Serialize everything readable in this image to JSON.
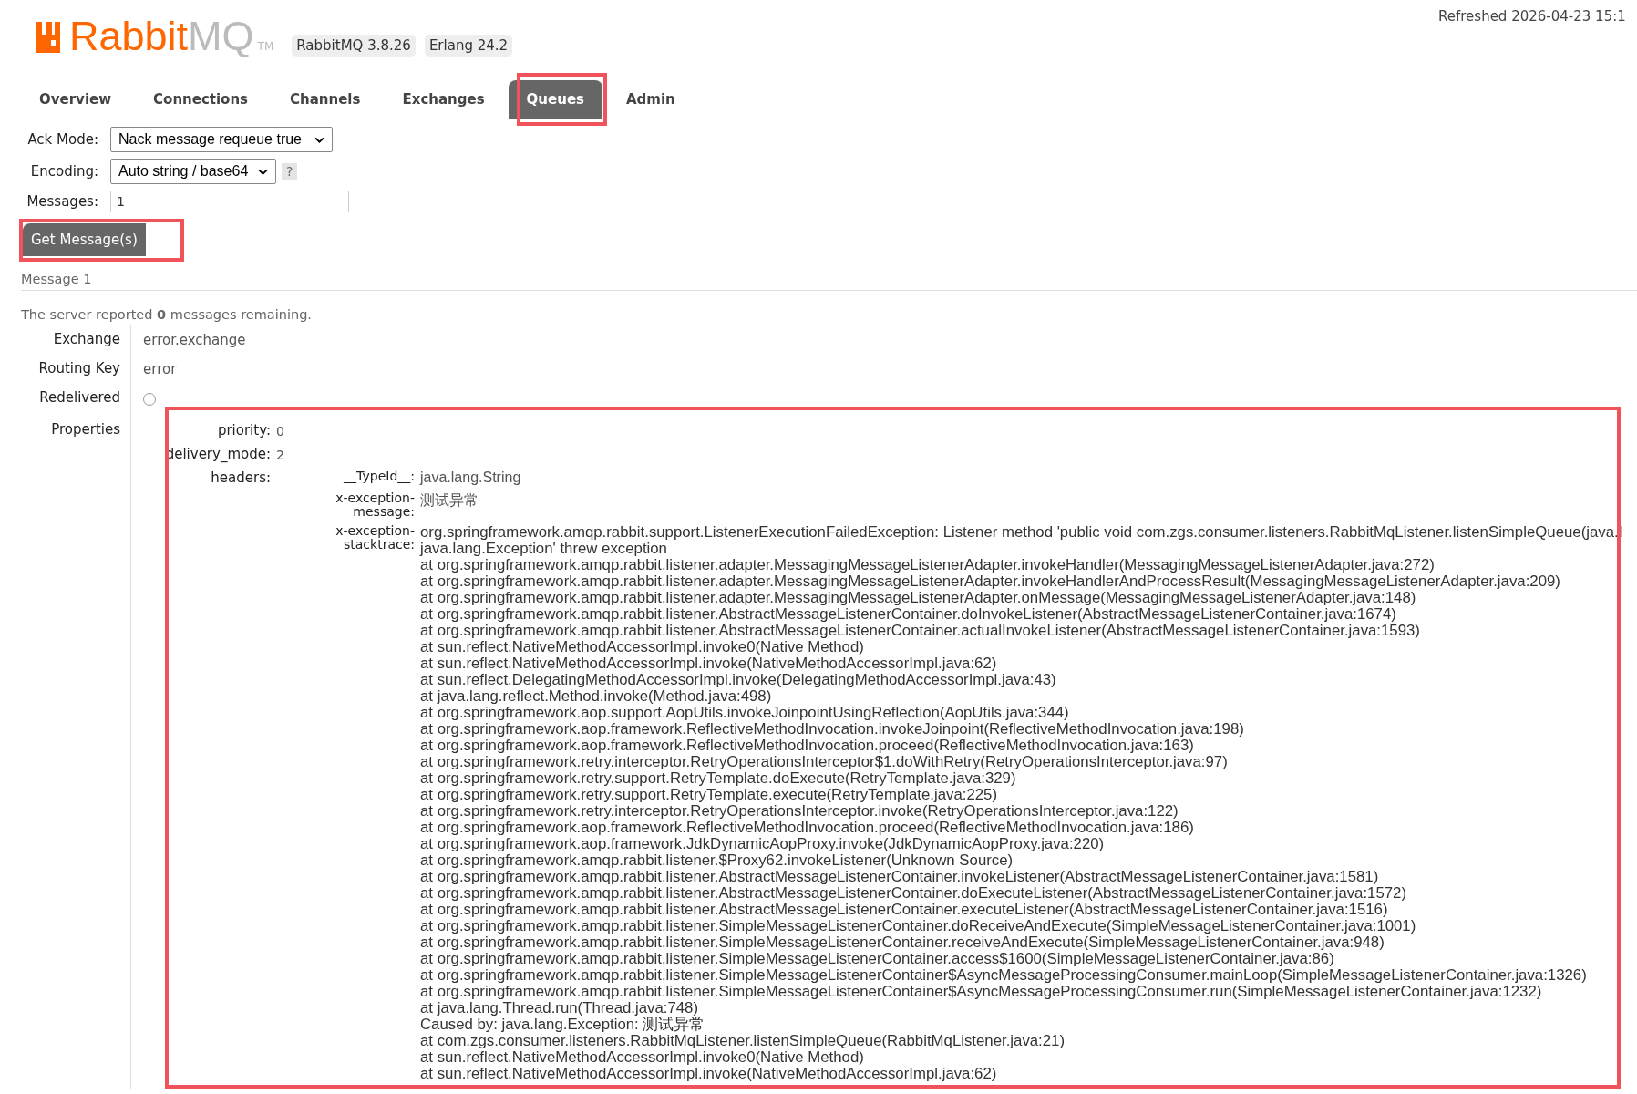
{
  "header": {
    "logo": {
      "brand": "Rabbit",
      "suffix": "MQ",
      "mark": "TM"
    },
    "badges": [
      "RabbitMQ 3.8.26",
      "Erlang 24.2"
    ],
    "refreshed": "Refreshed 2026-04-23 15:1"
  },
  "tabs": [
    {
      "label": "Overview",
      "selected": false
    },
    {
      "label": "Connections",
      "selected": false
    },
    {
      "label": "Channels",
      "selected": false
    },
    {
      "label": "Exchanges",
      "selected": false
    },
    {
      "label": "Queues",
      "selected": true
    },
    {
      "label": "Admin",
      "selected": false
    }
  ],
  "get_form": {
    "ack_mode": {
      "label": "Ack Mode:",
      "value": "Nack message requeue true"
    },
    "encoding": {
      "label": "Encoding:",
      "value": "Auto string / base64",
      "help": "?"
    },
    "messages": {
      "label": "Messages:",
      "value": "1"
    },
    "button": "Get Message(s)"
  },
  "message": {
    "heading": "Message 1",
    "remaining": "The server reported **0** messages remaining.",
    "fields": [
      {
        "label": "Exchange",
        "kind": "text",
        "value": "error.exchange"
      },
      {
        "label": "Routing Key",
        "kind": "text",
        "value": "error"
      },
      {
        "label": "Redelivered",
        "kind": "radio",
        "checked": false
      },
      {
        "label": "Properties",
        "kind": "properties"
      }
    ],
    "properties": [
      {
        "key": "priority:",
        "value": "0"
      },
      {
        "key": "delivery_mode:",
        "value": "2"
      },
      {
        "key": "headers:",
        "headers": [
          {
            "key": "__TypeId__:",
            "value": "java.lang.String"
          },
          {
            "key": "x-exception-message:",
            "value": "测试异常"
          },
          {
            "key": "x-exception-stacktrace:",
            "lines": [
              "org.springframework.amqp.rabbit.support.ListenerExecutionFailedException: Listener method 'public void com.zgs.consumer.listeners.RabbitMqListener.listenSimpleQueue(java.l",
              "java.lang.Exception' threw exception",
              "at org.springframework.amqp.rabbit.listener.adapter.MessagingMessageListenerAdapter.invokeHandler(MessagingMessageListenerAdapter.java:272)",
              "at org.springframework.amqp.rabbit.listener.adapter.MessagingMessageListenerAdapter.invokeHandlerAndProcessResult(MessagingMessageListenerAdapter.java:209)",
              "at org.springframework.amqp.rabbit.listener.adapter.MessagingMessageListenerAdapter.onMessage(MessagingMessageListenerAdapter.java:148)",
              "at org.springframework.amqp.rabbit.listener.AbstractMessageListenerContainer.doInvokeListener(AbstractMessageListenerContainer.java:1674)",
              "at org.springframework.amqp.rabbit.listener.AbstractMessageListenerContainer.actualInvokeListener(AbstractMessageListenerContainer.java:1593)",
              "at sun.reflect.NativeMethodAccessorImpl.invoke0(Native Method)",
              "at sun.reflect.NativeMethodAccessorImpl.invoke(NativeMethodAccessorImpl.java:62)",
              "at sun.reflect.DelegatingMethodAccessorImpl.invoke(DelegatingMethodAccessorImpl.java:43)",
              "at java.lang.reflect.Method.invoke(Method.java:498)",
              "at org.springframework.aop.support.AopUtils.invokeJoinpointUsingReflection(AopUtils.java:344)",
              "at org.springframework.aop.framework.ReflectiveMethodInvocation.invokeJoinpoint(ReflectiveMethodInvocation.java:198)",
              "at org.springframework.aop.framework.ReflectiveMethodInvocation.proceed(ReflectiveMethodInvocation.java:163)",
              "at org.springframework.retry.interceptor.RetryOperationsInterceptor$1.doWithRetry(RetryOperationsInterceptor.java:97)",
              "at org.springframework.retry.support.RetryTemplate.doExecute(RetryTemplate.java:329)",
              "at org.springframework.retry.support.RetryTemplate.execute(RetryTemplate.java:225)",
              "at org.springframework.retry.interceptor.RetryOperationsInterceptor.invoke(RetryOperationsInterceptor.java:122)",
              "at org.springframework.aop.framework.ReflectiveMethodInvocation.proceed(ReflectiveMethodInvocation.java:186)",
              "at org.springframework.aop.framework.JdkDynamicAopProxy.invoke(JdkDynamicAopProxy.java:220)",
              "at org.springframework.amqp.rabbit.listener.$Proxy62.invokeListener(Unknown Source)",
              "at org.springframework.amqp.rabbit.listener.AbstractMessageListenerContainer.invokeListener(AbstractMessageListenerContainer.java:1581)",
              "at org.springframework.amqp.rabbit.listener.AbstractMessageListenerContainer.doExecuteListener(AbstractMessageListenerContainer.java:1572)",
              "at org.springframework.amqp.rabbit.listener.AbstractMessageListenerContainer.executeListener(AbstractMessageListenerContainer.java:1516)",
              "at org.springframework.amqp.rabbit.listener.SimpleMessageListenerContainer.doReceiveAndExecute(SimpleMessageListenerContainer.java:1001)",
              "at org.springframework.amqp.rabbit.listener.SimpleMessageListenerContainer.receiveAndExecute(SimpleMessageListenerContainer.java:948)",
              "at org.springframework.amqp.rabbit.listener.SimpleMessageListenerContainer.access$1600(SimpleMessageListenerContainer.java:86)",
              "at org.springframework.amqp.rabbit.listener.SimpleMessageListenerContainer$AsyncMessageProcessingConsumer.mainLoop(SimpleMessageListenerContainer.java:1326)",
              "at org.springframework.amqp.rabbit.listener.SimpleMessageListenerContainer$AsyncMessageProcessingConsumer.run(SimpleMessageListenerContainer.java:1232)",
              "at java.lang.Thread.run(Thread.java:748)",
              "Caused by: java.lang.Exception: 测试异常",
              "at com.zgs.consumer.listeners.RabbitMqListener.listenSimpleQueue(RabbitMqListener.java:21)",
              "at sun.reflect.NativeMethodAccessorImpl.invoke0(Native Method)",
              "at sun.reflect.NativeMethodAccessorImpl.invoke(NativeMethodAccessorImpl.java:62)"
            ]
          }
        ]
      }
    ]
  }
}
